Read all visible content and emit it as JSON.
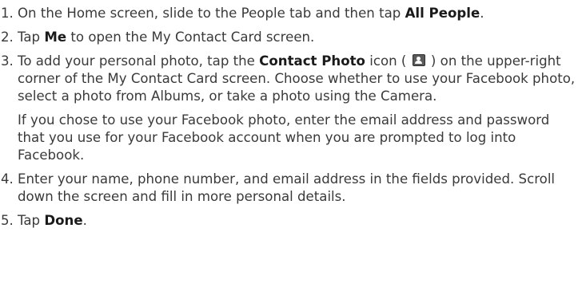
{
  "steps": [
    {
      "num": "1.",
      "t1": "On the Home screen, slide to the People tab and then tap ",
      "b1": "All People",
      "t2": "."
    },
    {
      "num": "2.",
      "t1": "Tap ",
      "b1": "Me",
      "t2": " to open the My Contact Card screen."
    },
    {
      "num": "3.",
      "t1": "To add your personal photo, tap the ",
      "b1": "Contact Photo",
      "t2": " icon ( ",
      "icon": "contact-photo-icon",
      "t3": " ) on the upper-right corner of the My Contact Card screen. Choose whether to use your Facebook photo, select a photo from Albums, or take a photo using the Camera.",
      "sub": "If you chose to use your Facebook photo, enter the email address and password that you use for your Facebook account when you are prompted to log into Facebook."
    },
    {
      "num": "4.",
      "t1": "Enter your name, phone number, and email address in the fields provided. Scroll down the screen and fill in more personal details."
    },
    {
      "num": "5.",
      "t1": "Tap ",
      "b1": "Done",
      "t2": "."
    }
  ]
}
